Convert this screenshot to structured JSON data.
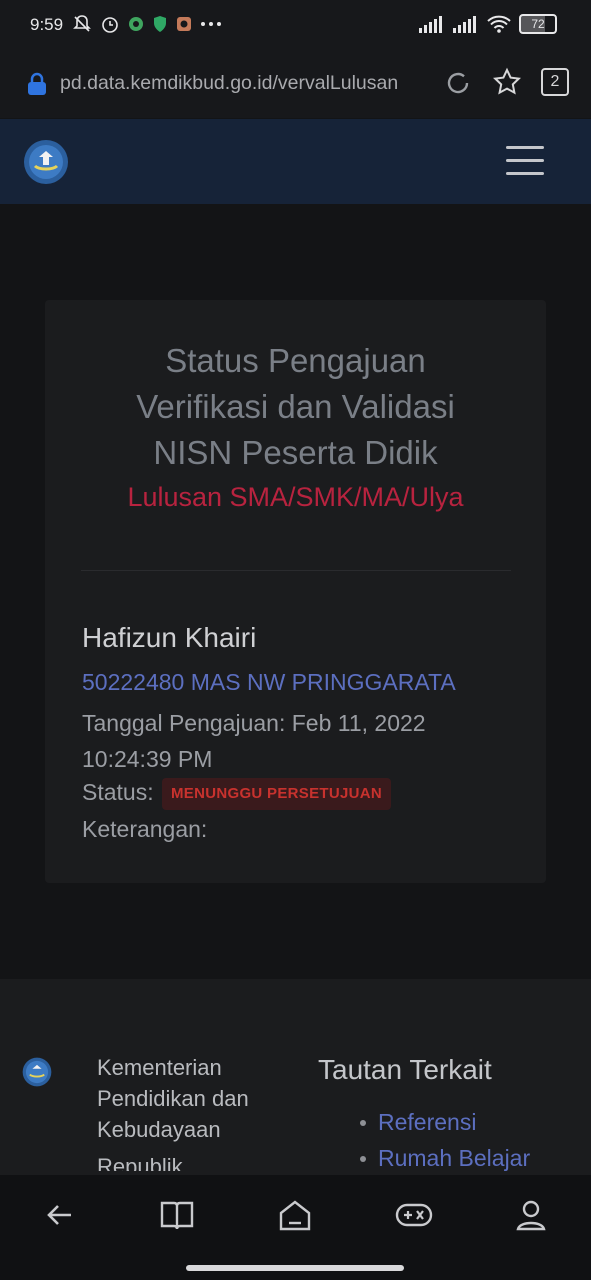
{
  "status_bar": {
    "time": "9:59",
    "battery": "72",
    "battery_level": 0.72,
    "icons_left": [
      "bell-off-icon",
      "alarm-icon",
      "whatsapp-icon",
      "shield-icon",
      "instagram-icon",
      "more-dots-icon"
    ],
    "icons_right": [
      "signal-icon",
      "signal-icon",
      "wifi-icon",
      "battery-icon"
    ]
  },
  "browser": {
    "url": "pd.data.kemdikbud.go.id/vervalLulusan",
    "tab_count": "2"
  },
  "card": {
    "title_lines": [
      "Status Pengajuan",
      "Verifikasi dan Validasi",
      "NISN Peserta Didik"
    ],
    "subtitle": "Lulusan SMA/SMK/MA/Ulya",
    "name": "Hafizun Khairi",
    "school": "50222480 MAS NW PRINGGARATA",
    "date_line1": "Tanggal Pengajuan: Feb 11, 2022",
    "date_line2": "10:24:39 PM",
    "status_label": "Status:",
    "status_value": "MENUNGGU PERSETUJUAN",
    "note_label": "Keterangan:"
  },
  "footer": {
    "ministry_lines": [
      "Kementerian",
      "Pendidikan dan",
      "Kebudayaan",
      "Republik"
    ],
    "links_title": "Tautan Terkait",
    "links": [
      "Referensi",
      "Rumah Belajar"
    ]
  },
  "colors": {
    "accent_link": "#5c6fc0",
    "subtitle_red": "#b8233f",
    "navbar": "#162338"
  }
}
